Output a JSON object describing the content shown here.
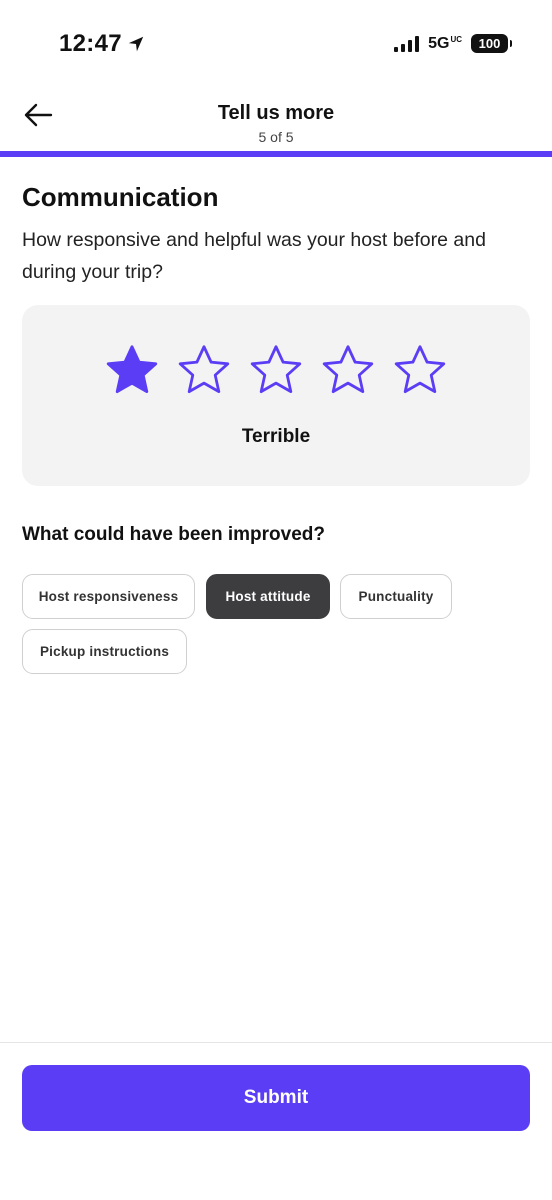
{
  "status_bar": {
    "time": "12:47",
    "network": "5G",
    "network_badge": "UC",
    "battery": "100"
  },
  "header": {
    "title": "Tell us more",
    "step": "5 of 5",
    "progress": 1.0
  },
  "section": {
    "title": "Communication",
    "question": "How responsive and helpful was your host before and during your trip?"
  },
  "rating": {
    "value": 1,
    "max": 5,
    "label": "Terrible"
  },
  "improvements": {
    "title": "What could have been improved?",
    "chips": [
      {
        "label": "Host responsiveness",
        "selected": false
      },
      {
        "label": "Host attitude",
        "selected": true
      },
      {
        "label": "Punctuality",
        "selected": false
      },
      {
        "label": "Pickup instructions",
        "selected": false
      }
    ]
  },
  "footer": {
    "submit_label": "Submit"
  },
  "colors": {
    "accent": "#5b3df5",
    "chip_selected": "#3d3d3f",
    "card_bg": "#f3f3f3"
  },
  "icons": {
    "back": "arrow-left-icon",
    "location": "location-arrow-icon",
    "star_filled": "star-filled-icon",
    "star_outline": "star-outline-icon"
  }
}
